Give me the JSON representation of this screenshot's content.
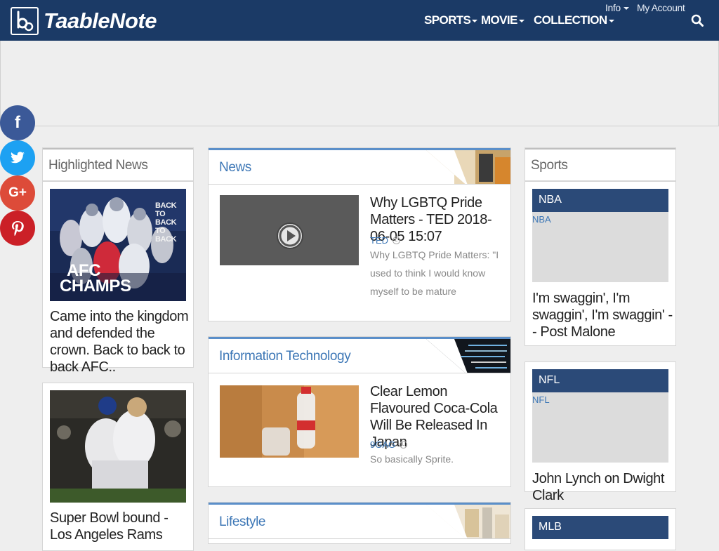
{
  "brand": {
    "name": "TaableNote"
  },
  "nav": {
    "items": [
      {
        "label": "SPORTS"
      },
      {
        "label": "MOVIE"
      },
      {
        "label": "COLLECTION"
      }
    ],
    "info_label": "Info",
    "account_label": "My Account"
  },
  "social": {
    "facebook": "f",
    "google_plus": "G+"
  },
  "highlighted": {
    "title": "Highlighted News",
    "cards": [
      {
        "title": "Came into the kingdom and defended the crown. Back to back to back AFC..",
        "image_text": [
          "AFC",
          "CHAMPS"
        ],
        "image_overlay": [
          "BACK",
          "TO",
          "BACK",
          "TO",
          "BACK"
        ]
      },
      {
        "title": "Super Bowl bound - Los Angeles Rams"
      }
    ]
  },
  "categories": [
    {
      "name": "News",
      "post_title": "Why LGBTQ Pride Matters - TED 2018-06-05 15:07",
      "source": "TED",
      "description": "Why LGBTQ Pride Matters: \"I used to think I would know myself to be mature"
    },
    {
      "name": "Information Technology",
      "post_title": "Clear Lemon Flavoured Coca-Cola Will Be Released In Japan",
      "source": "9GAG",
      "description": "So basically Sprite."
    },
    {
      "name": "Lifestyle"
    }
  ],
  "sports": {
    "title": "Sports",
    "cards": [
      {
        "league": "NBA",
        "tag": "NBA",
        "title": "I'm swaggin', I'm swaggin', I'm swaggin' -- Post Malone"
      },
      {
        "league": "NFL",
        "tag": "NFL",
        "title": "John Lynch on Dwight Clark"
      },
      {
        "league": "MLB"
      }
    ]
  },
  "colors": {
    "navbar": "#1b3a66",
    "accent": "#3d77b6",
    "sports_banner": "#2b4a78",
    "facebook": "#3b5998",
    "twitter": "#1da1f2",
    "google_plus": "#dd4b39",
    "pinterest": "#cb2027"
  },
  "icons": [
    "logo-icon",
    "search-icon",
    "facebook-icon",
    "twitter-icon",
    "google-plus-icon",
    "pinterest-icon",
    "play-icon",
    "clock-icon"
  ]
}
